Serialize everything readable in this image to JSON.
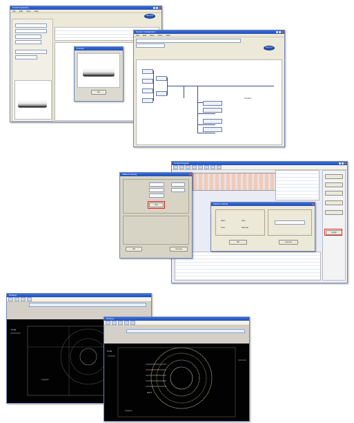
{
  "brand": {
    "logo_text": "SAMSUNG",
    "title_bar_color": "#2356c8",
    "highlight_color": "#e02020",
    "cad_background": "#000000"
  },
  "screens": {
    "product_viewer": {
      "title": "Product Selection",
      "menu": [
        "File",
        "Edit",
        "View",
        "Help"
      ],
      "popup_title": "Preview",
      "popup_button": "OK"
    },
    "flow_editor": {
      "title": "System Configuration",
      "menu": [
        "File",
        "Edit",
        "View",
        "Tools",
        "Help"
      ],
      "node_label": "Outdoor"
    },
    "dialog_settings": {
      "title": "Address Setting",
      "highlighted_button": "Set",
      "ok_button": "OK",
      "cancel_button": "Cancel"
    },
    "control_window": {
      "title": "Control Program",
      "inner_dialog_title": "Address Setting",
      "options": [
        "Main",
        "Sub",
        "Auto",
        "Manual"
      ],
      "ok_button": "OK",
      "cancel_button": "Cancel",
      "highlighted_button": "Apply"
    },
    "cad_back": {
      "title": "Drawing",
      "label_left": "PLAN",
      "label_bottom": "Layout"
    },
    "cad_front": {
      "title": "Drawing",
      "label_left": "PLAN",
      "label_center": "DUCT",
      "label_bottom": "Layout"
    }
  }
}
